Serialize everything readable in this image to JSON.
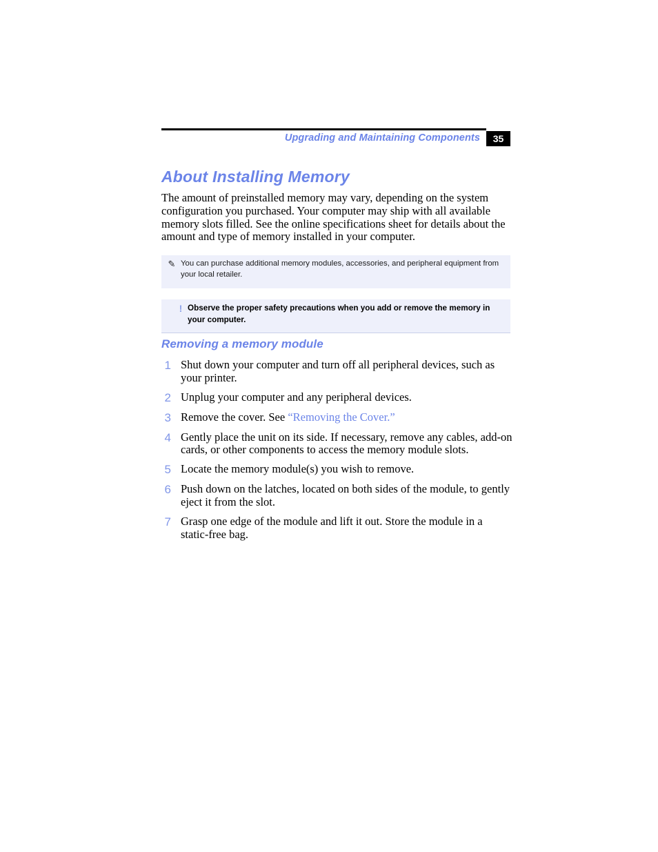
{
  "header": {
    "running_title": "Upgrading and Maintaining Components",
    "page_number": "35"
  },
  "title": "About Installing Memory",
  "intro_paragraph": "The amount of preinstalled memory may vary, depending on the system configuration you purchased. Your computer may ship with all available memory slots filled. See the online specifications sheet for details about the amount and type of memory installed in your computer.",
  "note": {
    "icon": "pencil-icon",
    "icon_glyph": "✎",
    "text": "You can purchase additional memory modules, accessories, and peripheral equipment from your local retailer."
  },
  "warning": {
    "icon": "exclamation-icon",
    "icon_glyph": "!",
    "text": "Observe the proper safety precautions when you add or remove the memory in your computer."
  },
  "subheading": "Removing a memory module",
  "steps": [
    {
      "number": "1",
      "text": "Shut down your computer and turn off all peripheral devices, such as your printer."
    },
    {
      "number": "2",
      "text": "Unplug your computer and any peripheral devices."
    },
    {
      "number": "3",
      "text": "Remove the cover. See ",
      "link": "“Removing the Cover.”"
    },
    {
      "number": "4",
      "text": "Gently place the unit on its side. If necessary, remove any cables, add-on cards, or other components to access the memory module slots."
    },
    {
      "number": "5",
      "text": "Locate the memory module(s) you wish to remove."
    },
    {
      "number": "6",
      "text": "Push down on the latches, located on both sides of the module, to gently eject it from the slot."
    },
    {
      "number": "7",
      "text": "Grasp one edge of the module and lift it out. Store the module in a static-free bag."
    }
  ],
  "colors": {
    "accent_blue": "#6b84e8",
    "step_number_blue": "#8096e8",
    "callout_background": "#eef0fb",
    "warning_icon_blue": "#8fa3e8",
    "page_number_background": "#000000"
  }
}
